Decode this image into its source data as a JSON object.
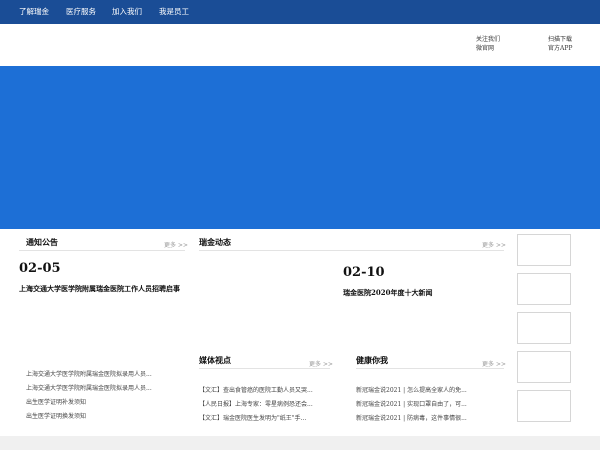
{
  "nav": {
    "items": [
      "了解瑞金",
      "医疗服务",
      "加入我们",
      "我是员工"
    ]
  },
  "header": {
    "follow_label": "关注我们",
    "wechat_label": "微官网",
    "scan_label": "扫描下载",
    "app_label": "官方APP"
  },
  "notices": {
    "title": "通知公告",
    "more": "更多 >>",
    "date": "02-05",
    "headline": "上海交通大学医学院附属瑞金医院工作人员招聘启事",
    "items": [
      "上海交通大学医学院附属瑞金医院拟录用人员...",
      "上海交通大学医学院附属瑞金医院拟录用人员...",
      "出生医学证明补发须知",
      "出生医学证明换发须知"
    ]
  },
  "news": {
    "title": "瑞金动态",
    "more": "更多 >>",
    "date": "02-10",
    "headline": "瑞金医院2020年度十大新闻"
  },
  "media": {
    "title": "媒体视点",
    "more": "更多 >>",
    "items": [
      "【文汇】查出食管癌的医院工勤人员又哭...",
      "【人民日报】上海专家：零星病例恐还会...",
      "【文汇】瑞金医院医生发明为\"纸王\"手..."
    ]
  },
  "health": {
    "title": "健康你我",
    "more": "更多 >>",
    "items": [
      "新冠瑞金说2021 | 怎么提高全家人的免...",
      "新冠瑞金说2021 | 实现口罩自由了，可...",
      "新冠瑞金说2021 | 防病毒，这件事情很..."
    ]
  },
  "colors": {
    "nav_bg": "#1a4d96",
    "banner_bg": "#1d6fd6"
  }
}
